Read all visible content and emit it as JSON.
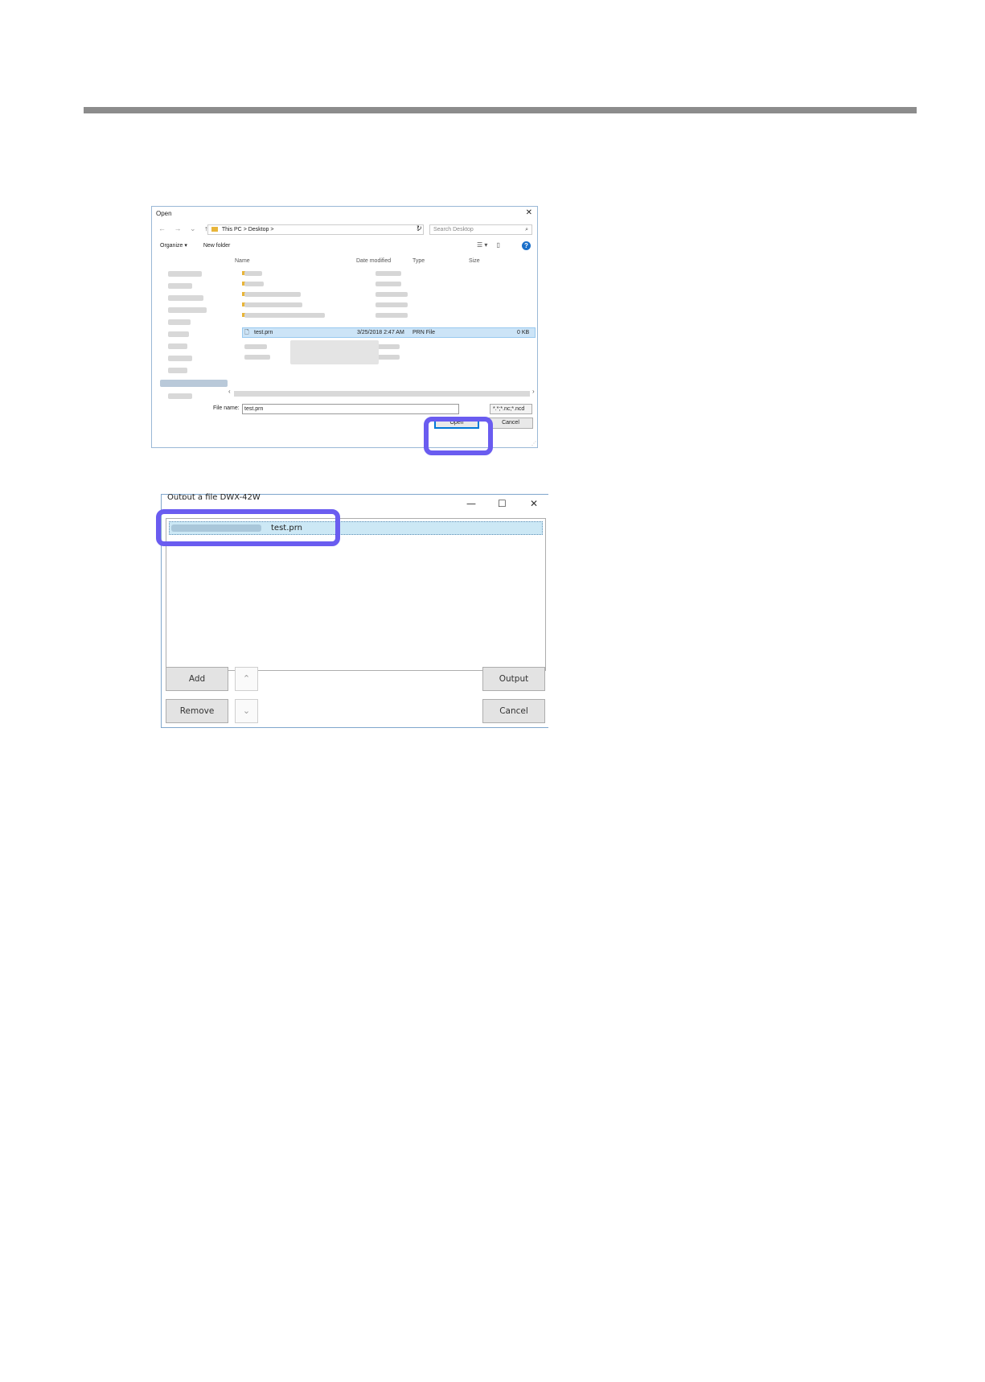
{
  "open_dialog": {
    "title": "Open",
    "close": "✕",
    "nav": {
      "back": "←",
      "forward": "→",
      "recent": "⌄",
      "up": "↑"
    },
    "breadcrumb": [
      "This PC",
      ">",
      "Desktop",
      ">"
    ],
    "search_placeholder": "Search Desktop",
    "toolbar": {
      "organize": "Organize ▾",
      "new_folder": "New folder"
    },
    "columns": {
      "name": "Name",
      "date": "Date modified",
      "type": "Type",
      "size": "Size"
    },
    "selected_file": {
      "name": "test.prn",
      "date": "3/25/2018 2:47 AM",
      "type": "PRN File",
      "size": "0 KB"
    },
    "file_name_label": "File name:",
    "file_name_value": "test.prn",
    "filter": "*.*;*.nc;*.ncd",
    "open_label": "Open",
    "cancel_label": "Cancel"
  },
  "output_dialog": {
    "title": "Output a file DWX-42W",
    "window_buttons": {
      "minimize": "—",
      "maximize": "☐",
      "close": "✕"
    },
    "file_item": "test.prn",
    "add_label": "Add",
    "remove_label": "Remove",
    "up_label": "⌃",
    "down_label": "⌄",
    "output_label": "Output",
    "cancel_label": "Cancel"
  },
  "colors": {
    "highlight": "#6a5cf0",
    "selection": "#cce4f7",
    "accent": "#0078d7"
  }
}
